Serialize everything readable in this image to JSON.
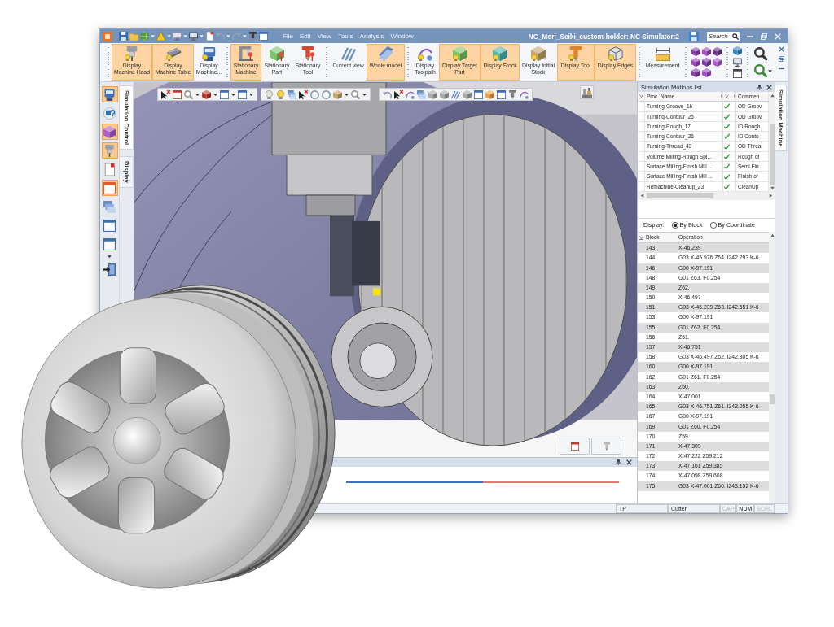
{
  "window": {
    "menu": [
      "File",
      "Edit",
      "View",
      "Tools",
      "Analysis",
      "Window"
    ],
    "title": "NC_Mori_Seiki_custom-holder: NC Simulator:2",
    "search": {
      "placeholder": "Search"
    }
  },
  "ribbon": {
    "groups": [
      {
        "buttons": [
          {
            "label": "Display Machine Head",
            "on": true
          },
          {
            "label": "Display Machine Table",
            "on": true
          },
          {
            "label": "Display Machine...",
            "on": false
          }
        ]
      },
      {
        "buttons": [
          {
            "label": "Stationary Machine",
            "on": true
          },
          {
            "label": "Stationary Part",
            "on": false
          },
          {
            "label": "Stationary Tool",
            "on": false
          }
        ]
      },
      {
        "buttons": [
          {
            "label": "Current view",
            "on": false
          },
          {
            "label": "Whole model",
            "on": true
          }
        ]
      },
      {
        "buttons": [
          {
            "label": "Display Toolpath",
            "on": false
          },
          {
            "label": "Display Target Part",
            "on": true
          },
          {
            "label": "Display Stock",
            "on": true
          },
          {
            "label": "Display Initial Stock",
            "on": false
          },
          {
            "label": "Display Tool",
            "on": true
          },
          {
            "label": "Display Edges",
            "on": true
          }
        ]
      },
      {
        "buttons": [
          {
            "label": "Measurement",
            "on": false
          }
        ]
      }
    ]
  },
  "left_toolbar": [
    {
      "on": true
    },
    {
      "on": false
    },
    {
      "on": true
    },
    {
      "on": true
    },
    {
      "on": false
    },
    {
      "on": true
    },
    {
      "on": false
    },
    {
      "on": false
    },
    {
      "on": false
    },
    {
      "on": false
    }
  ],
  "side_tabs": [
    {
      "label": "Simulation Control",
      "selected": true
    },
    {
      "label": "Display",
      "selected": false
    }
  ],
  "timeline": {
    "level": 0.5
  },
  "motions_panel": {
    "title": "Simulation Motions list",
    "columns": [
      "Proc. Name",
      "Commen"
    ],
    "rows": [
      {
        "name": "Turning-Groove_16",
        "checked": true,
        "comment": "OD Groov"
      },
      {
        "name": "Turning-Contour_25",
        "checked": true,
        "comment": "OD Groov"
      },
      {
        "name": "Turning-Rough_17",
        "checked": true,
        "comment": "ID Rough"
      },
      {
        "name": "Turning-Contour_26",
        "checked": true,
        "comment": "ID Conto"
      },
      {
        "name": "Turning-Thread_43",
        "checked": true,
        "comment": "OD Threa"
      },
      {
        "name": "Volume Milling-Rough Spi...",
        "checked": true,
        "comment": "Rough of"
      },
      {
        "name": "Surface Milling-Finish Mill ...",
        "checked": true,
        "comment": "Semi Fin"
      },
      {
        "name": "Surface Milling-Finish Mill ...",
        "checked": true,
        "comment": "Finish of"
      },
      {
        "name": "Remachine-Cleanup_23",
        "checked": true,
        "comment": "CleanUp"
      }
    ]
  },
  "program_panel": {
    "display_label": "Display:",
    "modes": [
      {
        "label": "By Block",
        "selected": true
      },
      {
        "label": "By Coordinate",
        "selected": false
      }
    ],
    "columns": [
      "Block",
      "Operation"
    ],
    "rows": [
      {
        "block": "143",
        "operation": "X-46.239"
      },
      {
        "block": "144",
        "operation": "G03 X-45.976 Z64. I242.293 K-6"
      },
      {
        "block": "146",
        "operation": "G00 X-97.191"
      },
      {
        "block": "148",
        "operation": "G01 Z63. F0.254"
      },
      {
        "block": "149",
        "operation": "Z62."
      },
      {
        "block": "150",
        "operation": "X-46.497"
      },
      {
        "block": "151",
        "operation": "G03 X-46.239 Z63. I242.551 K-6"
      },
      {
        "block": "153",
        "operation": "G00 X-97.191"
      },
      {
        "block": "155",
        "operation": "G01 Z62. F0.254"
      },
      {
        "block": "156",
        "operation": "Z61."
      },
      {
        "block": "157",
        "operation": "X-46.751"
      },
      {
        "block": "158",
        "operation": "G03 X-46.497 Z62. I242.805 K-6"
      },
      {
        "block": "160",
        "operation": "G00 X-97.191"
      },
      {
        "block": "162",
        "operation": "G01 Z61. F0.254"
      },
      {
        "block": "163",
        "operation": "Z60."
      },
      {
        "block": "164",
        "operation": "X-47.001"
      },
      {
        "block": "165",
        "operation": "G03 X-46.751 Z61. I243.055 K-6"
      },
      {
        "block": "167",
        "operation": "G00 X-97.191"
      },
      {
        "block": "169",
        "operation": "G01 Z60. F0.254"
      },
      {
        "block": "170",
        "operation": "Z59."
      },
      {
        "block": "171",
        "operation": "X-47.309"
      },
      {
        "block": "172",
        "operation": "X-47.222 Z59.212"
      },
      {
        "block": "173",
        "operation": "X-47.161 Z59.385"
      },
      {
        "block": "174",
        "operation": "X-47.098 Z59.608"
      },
      {
        "block": "175",
        "operation": "G03 X-47.001 Z60. I243.152 K-6"
      }
    ]
  },
  "right_tab": {
    "label": "Simulation Machine"
  },
  "status_bar": {
    "fields": [
      "TP",
      "Cutter"
    ],
    "indicators": [
      {
        "label": "CAP",
        "on": false
      },
      {
        "label": "NUM",
        "on": true
      },
      {
        "label": "SCRL",
        "on": false
      }
    ]
  }
}
